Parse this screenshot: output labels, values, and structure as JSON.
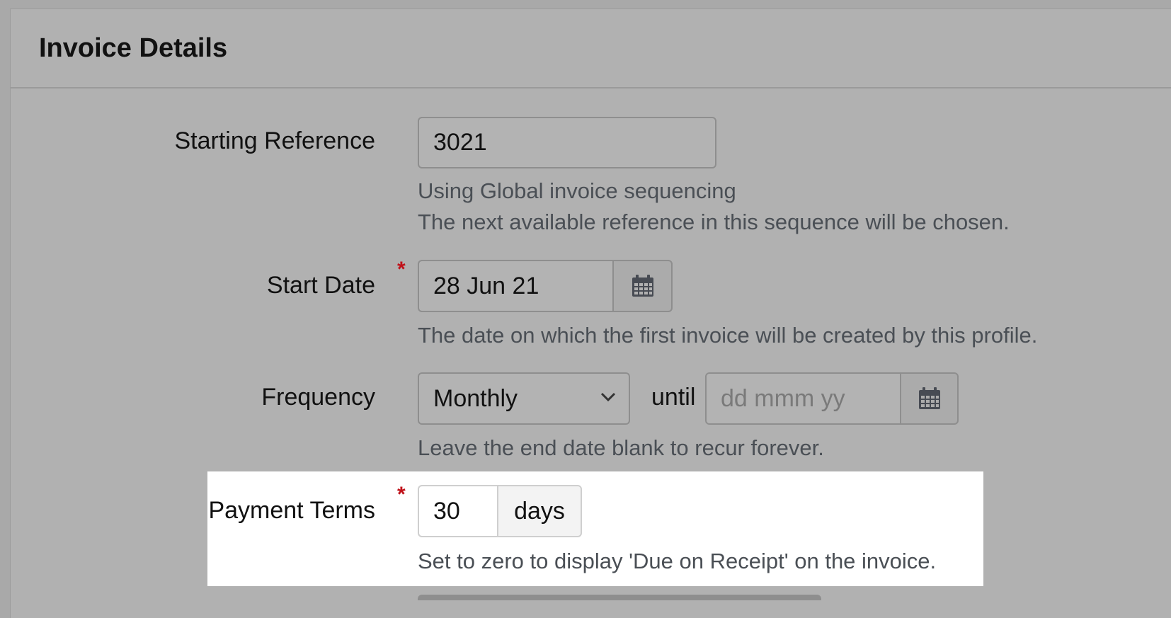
{
  "panel": {
    "title": "Invoice Details"
  },
  "fields": {
    "starting_reference": {
      "label": "Starting Reference",
      "value": "3021",
      "help_line1": "Using Global invoice sequencing",
      "help_line2": "The next available reference in this sequence will be chosen."
    },
    "start_date": {
      "label": "Start Date",
      "required_mark": "*",
      "value": "28 Jun 21",
      "help": "The date on which the first invoice will be created by this profile.",
      "icon": "calendar-icon"
    },
    "frequency": {
      "label": "Frequency",
      "selected": "Monthly",
      "until_label": "until",
      "end_date_placeholder": "dd mmm yy",
      "help": "Leave the end date blank to recur forever.",
      "icon": "calendar-icon"
    },
    "payment_terms": {
      "label": "Payment Terms",
      "required_mark": "*",
      "value": "30",
      "addon": "days",
      "help": "Set to zero to display 'Due on Receipt' on the invoice."
    }
  },
  "colors": {
    "required": "#c0121a",
    "help_text": "#4a4f55",
    "overlay": "#b1b1b1",
    "highlight": "#ffffff"
  }
}
